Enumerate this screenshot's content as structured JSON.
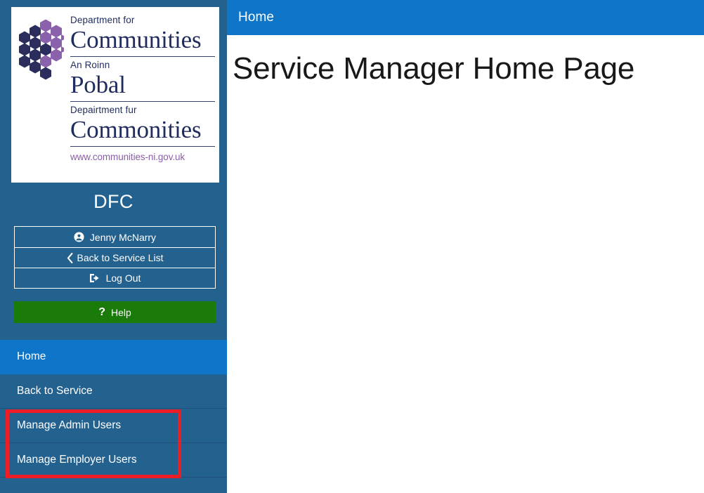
{
  "colors": {
    "sidebar_bg": "#23618f",
    "accent_blue": "#0e75c9",
    "help_green": "#1a7a0a",
    "highlight_red": "#ee1c25",
    "logo_navy": "#1f2c5c",
    "logo_purple": "#8b5fa8"
  },
  "sidebar": {
    "logo": {
      "icon_name": "dfc-hexagon-logo",
      "line1_small": "Department for",
      "line1_big": "Communities",
      "line2_small": "An Roinn",
      "line2_big": "Pobal",
      "line3_small": "Depairtment fur",
      "line3_big": "Commonities",
      "url": "www.communities-ni.gov.uk"
    },
    "org_title": "DFC",
    "buttons": [
      {
        "label": "Jenny McNarry",
        "icon": "user-circle-icon"
      },
      {
        "label": "Back to Service List",
        "icon": "chevron-left-icon"
      },
      {
        "label": "Log Out",
        "icon": "sign-out-icon"
      }
    ],
    "help": {
      "label": "Help",
      "icon": "question-mark-icon"
    },
    "nav_items": [
      {
        "label": "Home",
        "active": true
      },
      {
        "label": "Back to Service",
        "active": false
      },
      {
        "label": "Manage Admin Users",
        "active": false
      },
      {
        "label": "Manage Employer Users",
        "active": false
      }
    ]
  },
  "main": {
    "topbar_title": "Home",
    "page_title": "Service Manager Home Page"
  }
}
